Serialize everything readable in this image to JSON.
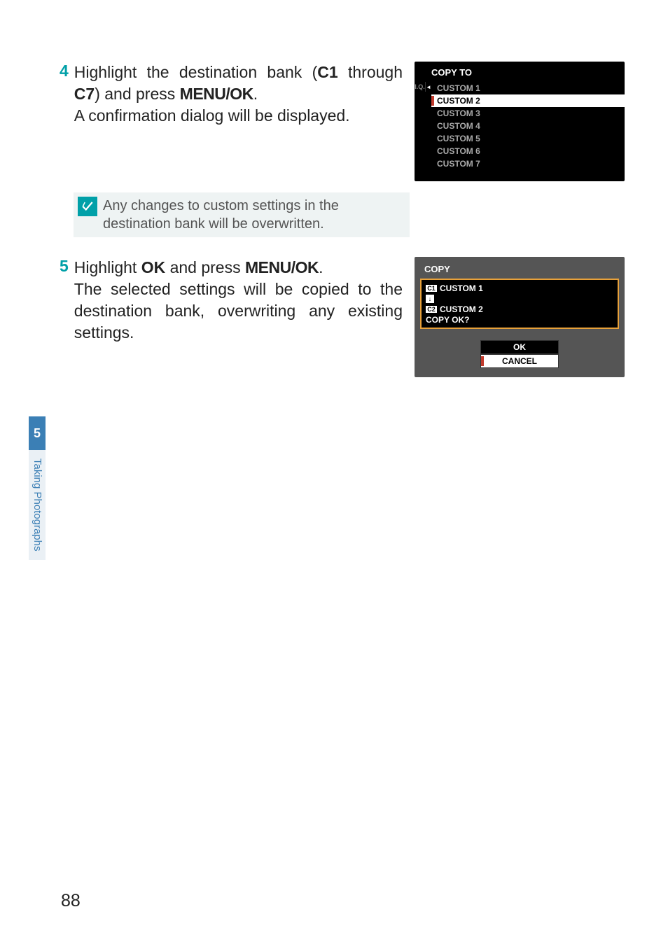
{
  "sidebar": {
    "chapter_number": "5",
    "chapter_label": "Taking Photographs"
  },
  "steps": {
    "s4": {
      "num": "4",
      "part1": "Highlight the destination bank (",
      "bold1": "C1",
      "part2": " through ",
      "bold2": "C7",
      "part3": ") and press ",
      "menuok": "MENU/OK",
      "part4": ".",
      "para2a": "A confirmation dialog will be dis",
      "para2b": "played."
    },
    "note": {
      "text": "Any changes to custom settings in the destination bank will be overwritten."
    },
    "s5": {
      "num": "5",
      "part1": "Highlight ",
      "bold1": "OK",
      "part2": " and press ",
      "menuok": "MENU/OK",
      "part3": ".",
      "para2": "The selected settings will be copied to the destination bank, overwriting any existing settings."
    }
  },
  "screen1": {
    "title": "COPY TO",
    "iq": "I.Q.",
    "arrow": "◄",
    "items": [
      {
        "label": "CUSTOM 1",
        "highlight": false
      },
      {
        "label": "CUSTOM 2",
        "highlight": true
      },
      {
        "label": "CUSTOM 3",
        "highlight": false
      },
      {
        "label": "CUSTOM 4",
        "highlight": false
      },
      {
        "label": "CUSTOM 5",
        "highlight": false
      },
      {
        "label": "CUSTOM 6",
        "highlight": false
      },
      {
        "label": "CUSTOM 7",
        "highlight": false
      }
    ]
  },
  "screen2": {
    "title": "COPY",
    "line1_badge": "C1",
    "line1_label": "CUSTOM 1",
    "arrow": "↓",
    "line2_badge": "C2",
    "line2_label": "CUSTOM 2",
    "prompt": "COPY OK?",
    "btn_ok": "OK",
    "btn_cancel": "CANCEL"
  },
  "page_number": "88"
}
